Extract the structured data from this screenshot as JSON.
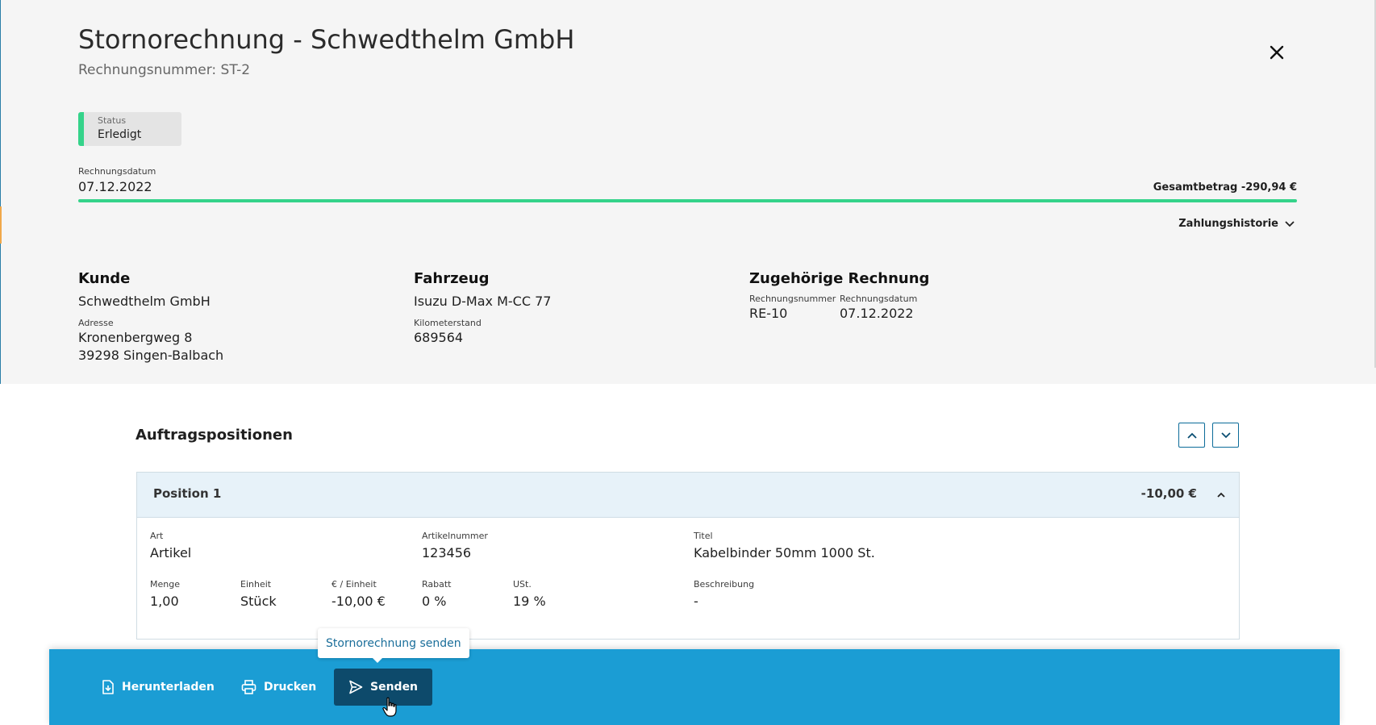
{
  "header": {
    "title": "Stornorechnung - Schwedthelm GmbH",
    "subtitle": "Rechnungsnummer: ST-2",
    "close_icon": "close-icon"
  },
  "status": {
    "label": "Status",
    "value": "Erledigt",
    "color": "#35d38a"
  },
  "invoice_date": {
    "label": "Rechnungsdatum",
    "value": "07.12.2022"
  },
  "total": "Gesamtbetrag -290,94 €",
  "payment_history": {
    "label": "Zahlungshistorie",
    "icon": "chevron-down-icon"
  },
  "customer": {
    "heading": "Kunde",
    "name": "Schwedthelm GmbH",
    "address_label": "Adresse",
    "address_line1": "Kronenbergweg 8",
    "address_line2": "39298 Singen-Balbach"
  },
  "vehicle": {
    "heading": "Fahrzeug",
    "name": "Isuzu D-Max M-CC 77",
    "mileage_label": "Kilometerstand",
    "mileage": "689564"
  },
  "related_invoice": {
    "heading": "Zugehörige Rechnung",
    "number_label": "Rechnungsnummer",
    "number": "RE-10",
    "date_label": "Rechnungsdatum",
    "date": "07.12.2022"
  },
  "positions": {
    "heading": "Auftragspositionen",
    "up_icon": "chevron-up-icon",
    "down_icon": "chevron-down-icon",
    "items": [
      {
        "title": "Position 1",
        "amount": "-10,00 €",
        "art_label": "Art",
        "art": "Artikel",
        "article_no_label": "Artikelnummer",
        "article_no": "123456",
        "titel_label": "Titel",
        "titel": "Kabelbinder 50mm 1000 St.",
        "menge_label": "Menge",
        "menge": "1,00",
        "einheit_label": "Einheit",
        "einheit": "Stück",
        "preis_label": "€ / Einheit",
        "preis": "-10,00 €",
        "rabatt_label": "Rabatt",
        "rabatt": "0 %",
        "ust_label": "USt.",
        "ust": "19 %",
        "beschreibung_label": "Beschreibung",
        "beschreibung": "-"
      }
    ]
  },
  "actions": {
    "download": "Herunterladen",
    "print": "Drucken",
    "send": "Senden",
    "tooltip": "Stornorechnung senden",
    "bar_color": "#1b9dd4",
    "send_color": "#0d4a6b"
  }
}
